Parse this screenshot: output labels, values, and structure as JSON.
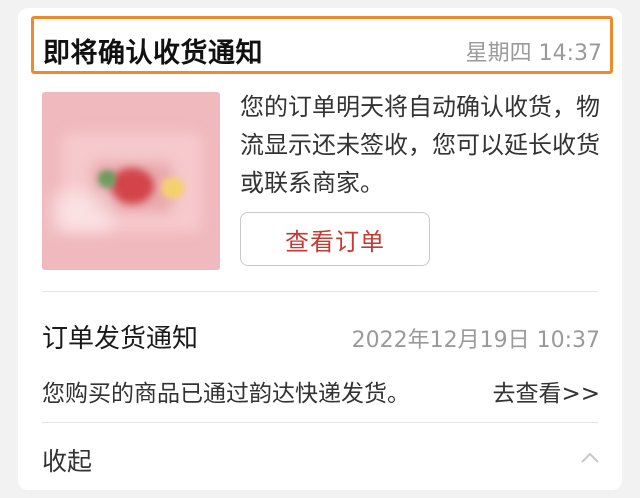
{
  "notification_main": {
    "title": "即将确认收货通知",
    "time": "星期四 14:37",
    "message": "您的订单明天将自动确认收货，物流显示还未签收，您可以延长收货或联系商家。",
    "button_label": "查看订单"
  },
  "notification_shipping": {
    "title": "订单发货通知",
    "time": "2022年12月19日 10:37",
    "body": "您购买的商品已通过韵达快递发货。",
    "link_label": "去查看>>"
  },
  "footer": {
    "collapse_label": "收起",
    "collapse_icon": "chevron-up-icon"
  },
  "colors": {
    "highlight_border": "#ef8a2b",
    "button_text": "#c43a32"
  }
}
